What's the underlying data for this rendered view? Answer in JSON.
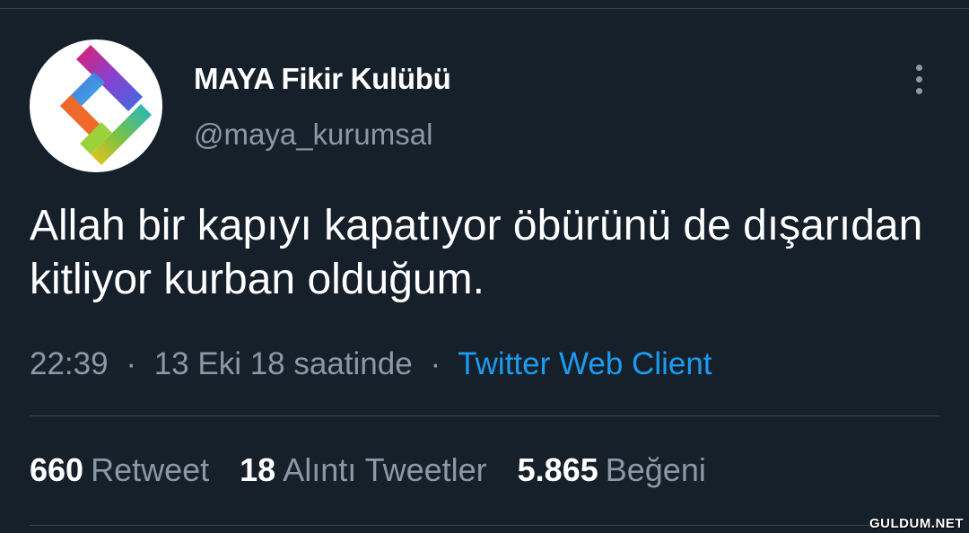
{
  "tweet": {
    "display_name": "MAYA Fikir Kulübü",
    "handle": "@maya_kurumsal",
    "text": "Allah bir kapıyı kapatıyor öbürünü de dışarıdan kitliyor kurban olduğum.",
    "time": "22:39",
    "date": "13 Eki 18 saatinde",
    "separator": "·",
    "source": "Twitter Web Client"
  },
  "stats": [
    {
      "count": "660",
      "label": "Retweet"
    },
    {
      "count": "18",
      "label": "Alıntı Tweetler"
    },
    {
      "count": "5.865",
      "label": "Beğeni"
    }
  ],
  "icons": {
    "avatar": "maya-logo-icon",
    "more": "more-vertical-icon"
  },
  "colors": {
    "background": "#15202b",
    "secondary_text": "#8b98a5",
    "link": "#1d9bf0",
    "divider": "#38444d"
  },
  "watermark": "GULDUM.NET"
}
